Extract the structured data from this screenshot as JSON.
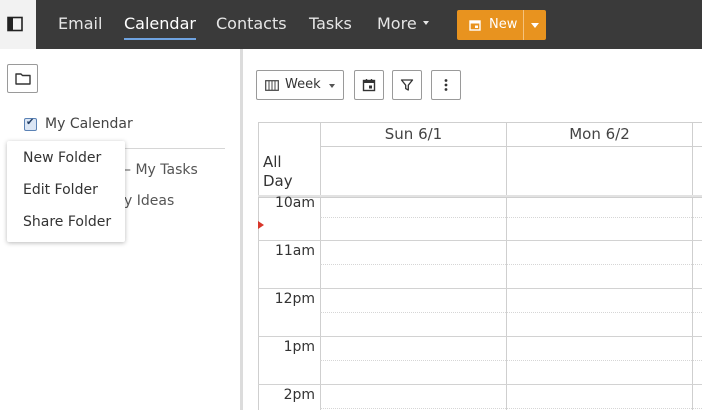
{
  "nav": {
    "items": [
      {
        "label": "Email",
        "active": false
      },
      {
        "label": "Calendar",
        "active": true
      },
      {
        "label": "Contacts",
        "active": false
      },
      {
        "label": "Tasks",
        "active": false
      },
      {
        "label": "More",
        "active": false
      }
    ],
    "new_label": "New"
  },
  "sidebar": {
    "calendar_label": "My Calendar",
    "tasks_label": "– My Tasks",
    "ideas_label": "y Ideas"
  },
  "context_menu": {
    "items": [
      "New Folder",
      "Edit Folder",
      "Share Folder"
    ]
  },
  "toolbar": {
    "view_label": "Week",
    "icons": [
      "calendar-today-icon",
      "filter-icon",
      "more-vertical-icon"
    ]
  },
  "calendar": {
    "days": [
      "Sun 6/1",
      "Mon 6/2"
    ],
    "allday_label": "All Day",
    "hours": [
      "10am",
      "11am",
      "12pm",
      "1pm",
      "2pm"
    ]
  },
  "colors": {
    "topbar": "#3a3a3a",
    "new_button": "#e8931f",
    "active_underline": "#6fa3e0",
    "now_marker": "#d8372a"
  }
}
